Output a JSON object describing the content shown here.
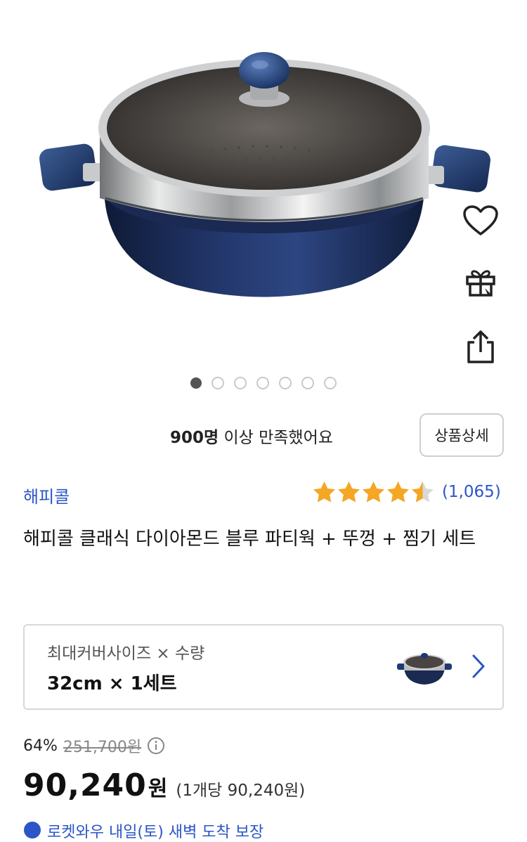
{
  "product": {
    "brand": "해피콜",
    "title": "해피콜 클래식 다이아몬드 블루 파티웍 + 뚜껑 + 찜기 세트",
    "rating_value": 4.5,
    "review_count": "(1,065)"
  },
  "gallery": {
    "total_images": 7,
    "active_index": 0
  },
  "side_actions": {
    "wishlist_icon": "heart-icon",
    "gift_icon": "gift-icon",
    "share_icon": "share-icon"
  },
  "satisfaction": {
    "count": "900명",
    "suffix": " 이상 만족했어요",
    "detail_button": "상품상세"
  },
  "option": {
    "label": "최대커버사이즈 × 수량",
    "value": "32cm × 1세트"
  },
  "price": {
    "discount_pct": "64%",
    "original_price": "251,700원",
    "final_price": "90,240",
    "currency": "원",
    "unit_price": "(1개당 90,240원)"
  },
  "delivery": {
    "text": "로켓와우 내일(토) 새벽 도착 보장"
  },
  "colors": {
    "accent_blue": "#2b56c7",
    "star": "#f5a623",
    "pan_navy": "#1c2c55"
  }
}
